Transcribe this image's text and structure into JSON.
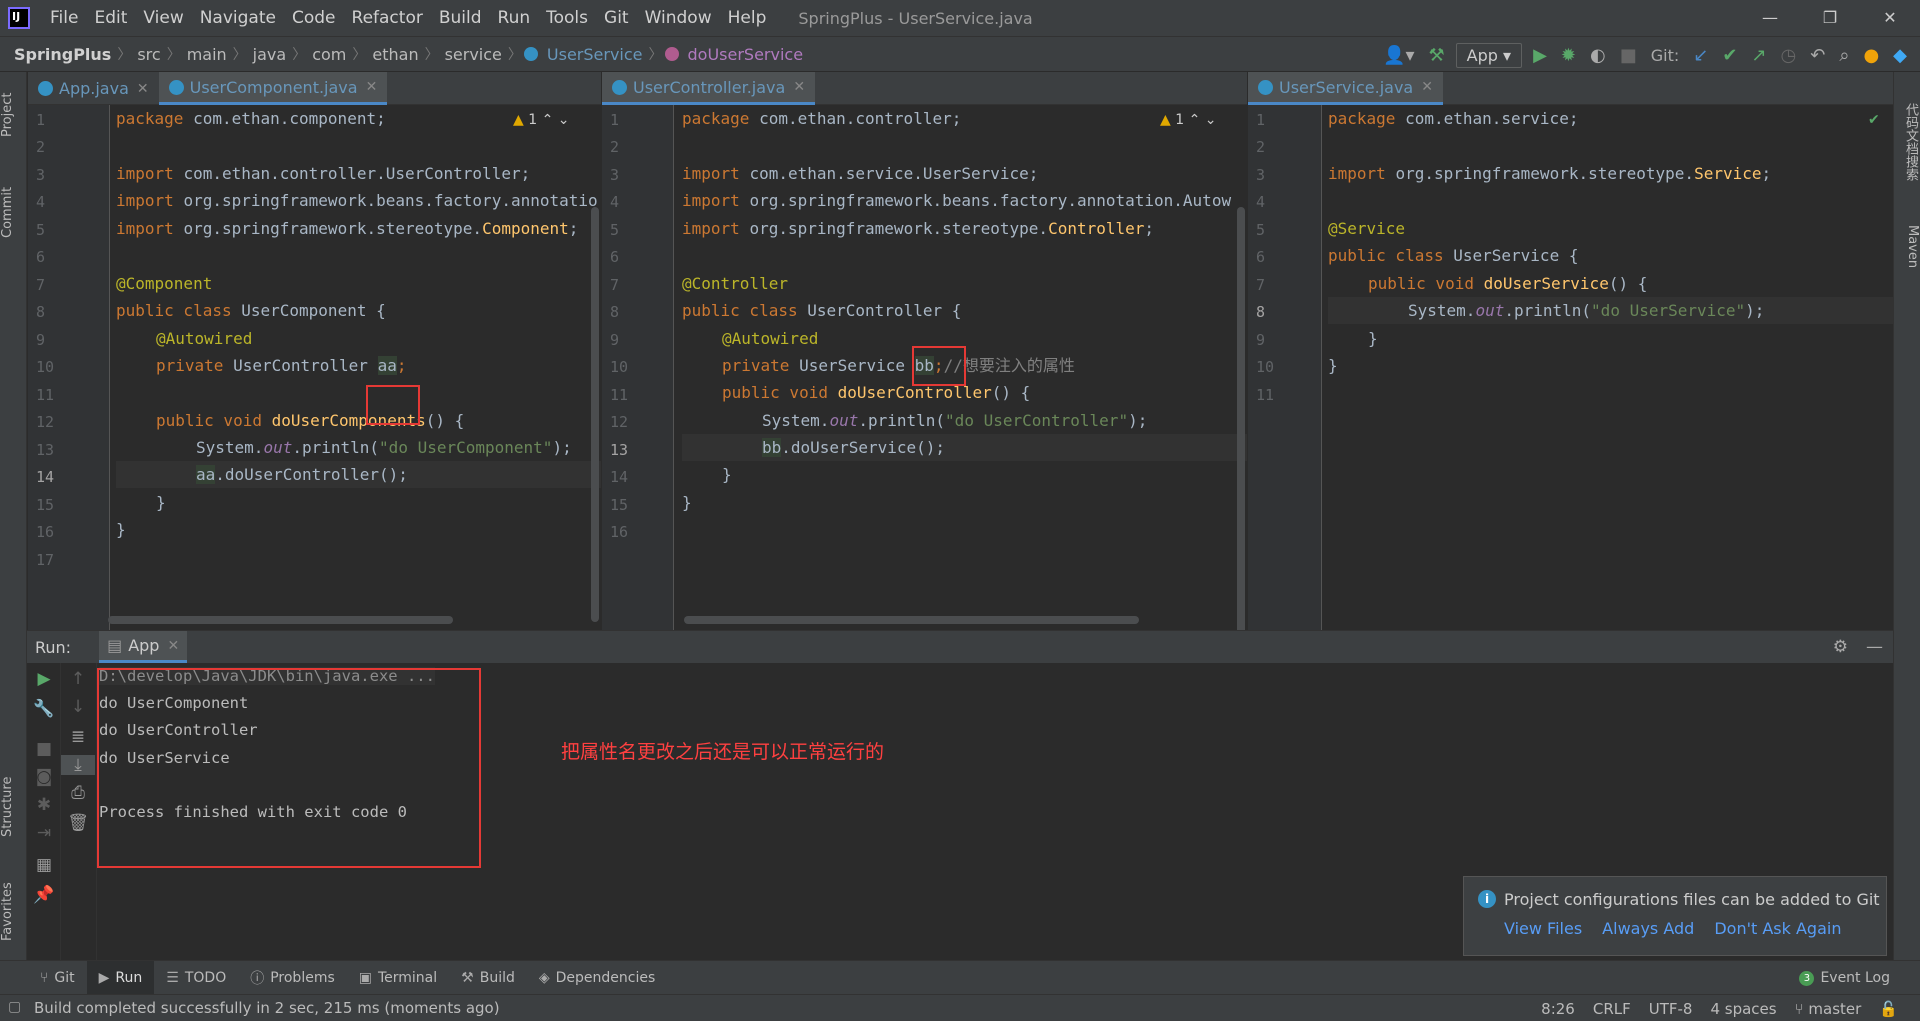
{
  "window": {
    "title": "SpringPlus - UserService.java",
    "menu": [
      "File",
      "Edit",
      "View",
      "Navigate",
      "Code",
      "Refactor",
      "Build",
      "Run",
      "Tools",
      "Git",
      "Window",
      "Help"
    ],
    "controls": [
      "—",
      "❐",
      "✕"
    ]
  },
  "breadcrumbs": [
    "SpringPlus",
    "src",
    "main",
    "java",
    "com",
    "ethan",
    "service",
    "UserService",
    "doUserService"
  ],
  "toolbar": {
    "run_config": "App",
    "git_label": "Git:"
  },
  "left_strip": [
    "Project",
    "Commit",
    "Structure",
    "Favorites"
  ],
  "right_strip": [
    "代码文档搜索",
    "Maven"
  ],
  "editors": [
    {
      "tabs": [
        {
          "label": "App.java",
          "active": false
        },
        {
          "label": "UserComponent.java",
          "active": true
        }
      ],
      "warning_count": "1",
      "line_numbers": [
        "1",
        "2",
        "3",
        "4",
        "5",
        "6",
        "7",
        "8",
        "9",
        "10",
        "11",
        "12",
        "13",
        "14",
        "15",
        "16",
        "17"
      ],
      "current_line": "14"
    },
    {
      "tabs": [
        {
          "label": "UserController.java",
          "active": true
        }
      ],
      "warning_count": "1",
      "line_numbers": [
        "1",
        "2",
        "3",
        "4",
        "5",
        "6",
        "7",
        "8",
        "9",
        "10",
        "11",
        "12",
        "13",
        "14",
        "15",
        "16"
      ],
      "current_line": "13"
    },
    {
      "tabs": [
        {
          "label": "UserService.java",
          "active": true
        }
      ],
      "line_numbers": [
        "1",
        "2",
        "3",
        "4",
        "5",
        "6",
        "7",
        "8",
        "9",
        "10",
        "11"
      ],
      "current_line": "8"
    }
  ],
  "code": {
    "c1": {
      "l1a": "package ",
      "l1b": "com.ethan.component;",
      "l3a": "import ",
      "l3b": "com.ethan.controller.UserController;",
      "l4a": "import ",
      "l4b": "org.springframework.beans.factory.annotatio",
      "l5a": "import ",
      "l5b": "org.springframework.stereotype.",
      "l5c": "Component",
      "l5d": ";",
      "l7": "@Component",
      "l8a": "public class ",
      "l8b": "UserComponent {",
      "l9": "@Autowired",
      "l10a": "private ",
      "l10b": "UserController ",
      "l10c": "aa",
      "l10d": ";",
      "l12a": "public void ",
      "l12b": "doUserComponents",
      "l12c": "() {",
      "l13a": "System.",
      "l13b": "out",
      "l13c": ".println(",
      "l13d": "\"do UserComponent\"",
      "l13e": ");",
      "l14a": "aa",
      "l14b": ".doUserController();",
      "l15": "}",
      "l16": "}"
    },
    "c2": {
      "l1a": "package ",
      "l1b": "com.ethan.controller;",
      "l3a": "import ",
      "l3b": "com.ethan.service.UserService;",
      "l4a": "import ",
      "l4b": "org.springframework.beans.factory.annotation.Autow",
      "l5a": "import ",
      "l5b": "org.springframework.stereotype.",
      "l5c": "Controller",
      "l5d": ";",
      "l7": "@Controller",
      "l8a": "public class ",
      "l8b": "UserController {",
      "l9": "@Autowired",
      "l10a": "private ",
      "l10b": "UserService ",
      "l10c": "bb",
      "l10d": ";",
      "l10e": "//想要注入的属性",
      "l11a": "public void ",
      "l11b": "doUserController",
      "l11c": "() {",
      "l12a": "System.",
      "l12b": "out",
      "l12c": ".println(",
      "l12d": "\"do UserController\"",
      "l12e": ");",
      "l13a": "bb",
      "l13b": ".doUserService();",
      "l14": "}",
      "l15": "}"
    },
    "c3": {
      "l1a": "package ",
      "l1b": "com.ethan.service;",
      "l3a": "import ",
      "l3b": "org.springframework.stereotype.",
      "l3c": "Service",
      "l3d": ";",
      "l5": "@Service",
      "l6a": "public class ",
      "l6b": "UserService {",
      "l7a": "public void ",
      "l7b": "doUserService",
      "l7c": "() {",
      "l8a": "System.",
      "l8b": "out",
      "l8c": ".println(",
      "l8d": "\"do UserService\"",
      "l8e": ");",
      "l9": "}",
      "l10": "}"
    }
  },
  "run_panel": {
    "label": "Run:",
    "tab": "App",
    "console": [
      "D:\\develop\\Java\\JDK\\bin\\java.exe ...",
      "do UserComponent",
      "do UserController",
      "do UserService",
      "",
      "Process finished with exit code 0"
    ],
    "annotation": "把属性名更改之后还是可以正常运行的"
  },
  "notification": {
    "message": "Project configurations files can be added to Git",
    "actions": [
      "View Files",
      "Always Add",
      "Don't Ask Again"
    ]
  },
  "bottom_tabs": [
    "Git",
    "Run",
    "TODO",
    "Problems",
    "Terminal",
    "Build",
    "Dependencies"
  ],
  "event_log": {
    "badge": "3",
    "label": "Event Log"
  },
  "status": {
    "message": "Build completed successfully in 2 sec, 215 ms (moments ago)",
    "position": "8:26",
    "line_sep": "CRLF",
    "encoding": "UTF-8",
    "indent": "4 spaces",
    "branch": "master"
  }
}
